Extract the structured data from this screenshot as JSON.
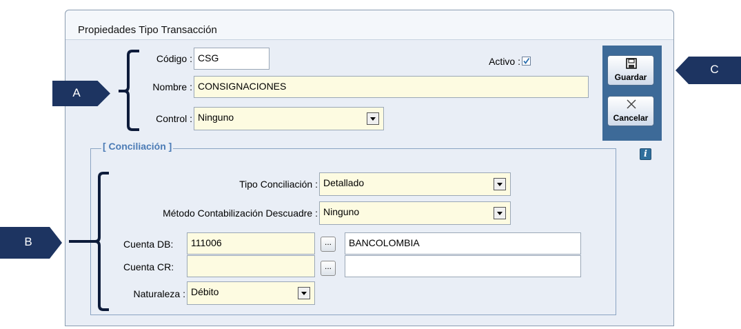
{
  "window": {
    "title": "Propiedades Tipo Transacción"
  },
  "form": {
    "codigo_label": "Código :",
    "codigo_value": "CSG",
    "activo_label": "Activo :",
    "nombre_label": "Nombre :",
    "nombre_value": "CONSIGNACIONES",
    "control_label": "Control :",
    "control_value": "Ninguno"
  },
  "toolbar": {
    "save_label": "Guardar",
    "cancel_label": "Cancelar"
  },
  "conciliacion": {
    "group_title": "[ Conciliación ]",
    "tipo_label": "Tipo Conciliación :",
    "tipo_value": "Detallado",
    "metodo_label": "Método Contabilización Descuadre :",
    "metodo_value": "Ninguno",
    "cuenta_db_label": "Cuenta DB:",
    "cuenta_db_value": "111006",
    "cuenta_db_name": "BANCOLOMBIA",
    "cuenta_cr_label": "Cuenta CR:",
    "cuenta_cr_value": "",
    "cuenta_cr_name": "",
    "naturaleza_label": "Naturaleza :",
    "naturaleza_value": "Débito",
    "ellipsis": "..."
  },
  "callouts": {
    "a": "A",
    "b": "B",
    "c": "C"
  },
  "colors": {
    "callout": "#1d3461",
    "bracket": "#0d1b3a",
    "field_bg": "#fdfbe1",
    "toolbar": "#3d6a98"
  },
  "icons": [
    "save-icon",
    "cancel-icon",
    "info-icon",
    "check-icon",
    "chevron-down-icon"
  ],
  "state": {
    "activo_checked": true
  }
}
